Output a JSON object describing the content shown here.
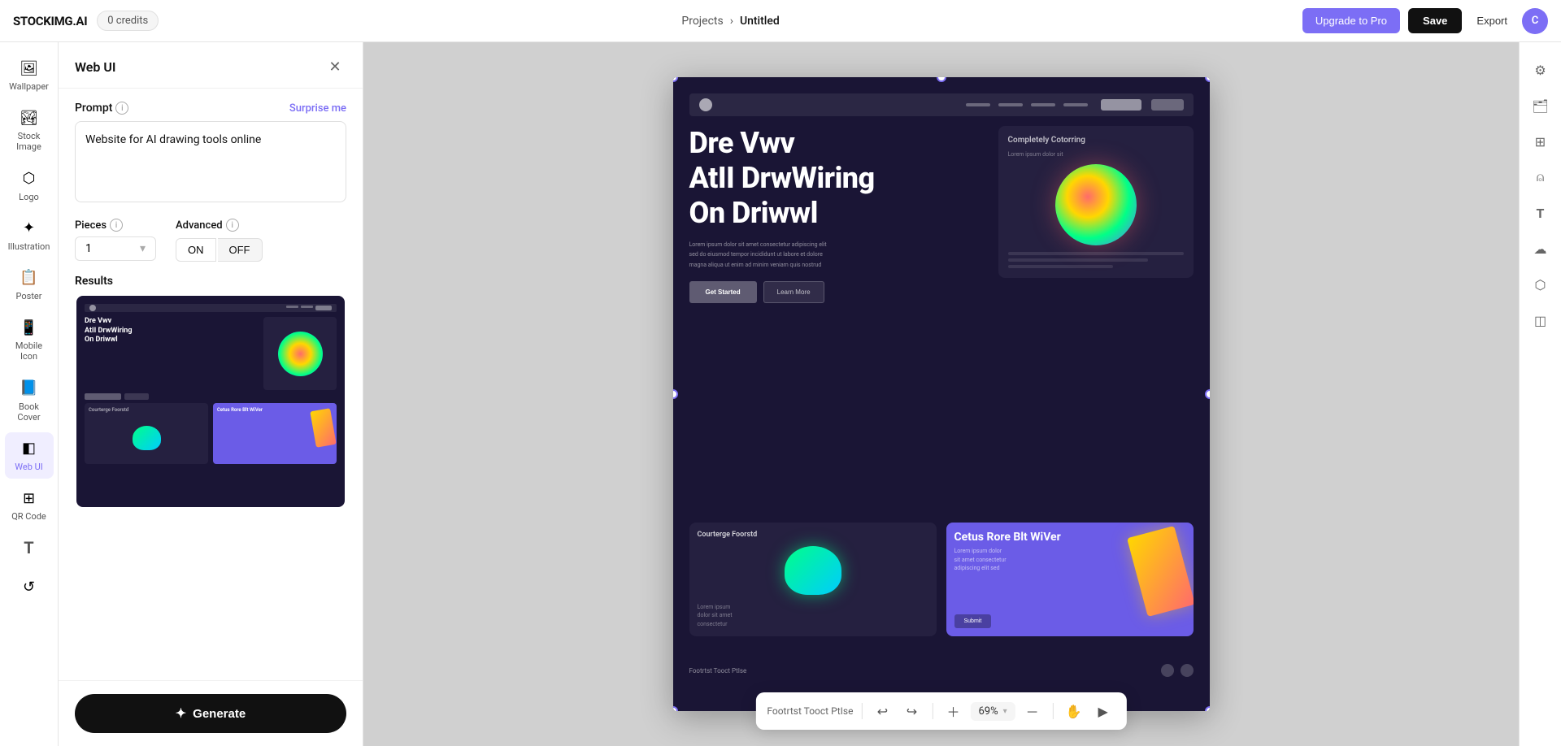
{
  "header": {
    "logo": "STOCKIMG.AI",
    "credits": "0 credits",
    "breadcrumb_projects": "Projects",
    "breadcrumb_sep": "›",
    "breadcrumb_current": "Untitled",
    "btn_upgrade": "Upgrade to Pro",
    "btn_save": "Save",
    "btn_export": "Export",
    "avatar_initials": "C"
  },
  "sidebar": {
    "items": [
      {
        "id": "wallpaper",
        "label": "Wallpaper",
        "icon": "🖼"
      },
      {
        "id": "stock-image",
        "label": "Stock Image",
        "icon": "🏞"
      },
      {
        "id": "logo",
        "label": "Logo",
        "icon": "⬡"
      },
      {
        "id": "illustration",
        "label": "Illustration",
        "icon": "✦"
      },
      {
        "id": "poster",
        "label": "Poster",
        "icon": "📋"
      },
      {
        "id": "mobile-icon",
        "label": "Mobile Icon",
        "icon": "📱"
      },
      {
        "id": "book-cover",
        "label": "Book Cover",
        "icon": "📘"
      },
      {
        "id": "web-ui",
        "label": "Web UI",
        "icon": "◧"
      },
      {
        "id": "qr-code",
        "label": "QR Code",
        "icon": "⊞"
      },
      {
        "id": "text",
        "label": "T",
        "icon": "T"
      },
      {
        "id": "history",
        "label": "",
        "icon": "↺"
      }
    ]
  },
  "panel": {
    "title": "Web UI",
    "prompt_label": "Prompt",
    "surprise_me": "Surprise me",
    "prompt_value": "Website for AI drawing tools online",
    "pieces_label": "Pieces",
    "pieces_value": "1",
    "advanced_label": "Advanced",
    "toggle_on": "ON",
    "toggle_off": "OFF",
    "results_label": "Results",
    "generate_btn": "Generate"
  },
  "canvas": {
    "hero_title_line1": "Dre Vwv",
    "hero_title_line2": "AtII DrwWiring",
    "hero_title_line3": "On Driwwl",
    "feature_card_title": "Completely Cotorring",
    "card_dark_title": "Courterge Foorstd",
    "card_purple_title": "Cetus Rore Blt WiVer",
    "footer_text": "Footrtst Tooct PtIse"
  },
  "toolbar": {
    "footer_text": "Footrtst Tooct PtIse",
    "zoom_value": "69%"
  },
  "right_sidebar": {
    "icons": [
      "⚙",
      "🗂",
      "⊞",
      "⍝",
      "T",
      "☁",
      "⬡",
      "◫"
    ]
  }
}
